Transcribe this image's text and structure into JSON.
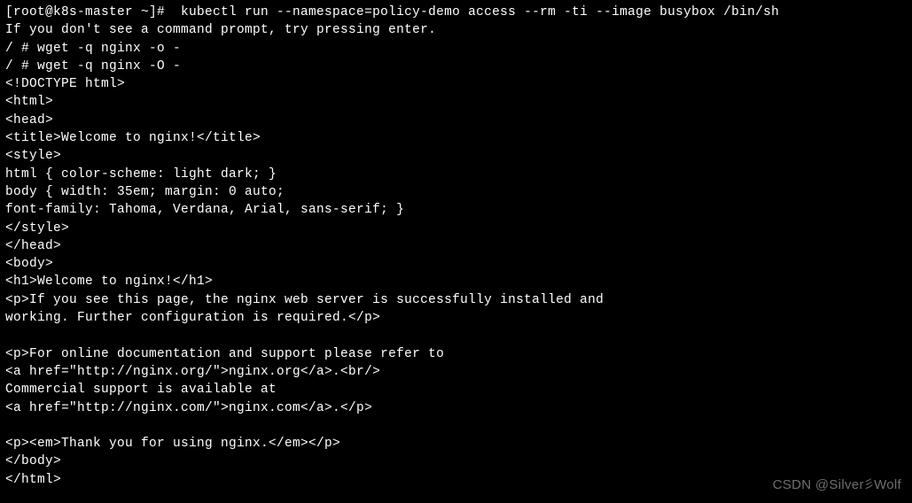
{
  "terminal": {
    "lines": [
      "[root@k8s-master ~]#  kubectl run --namespace=policy-demo access --rm -ti --image busybox /bin/sh",
      "If you don't see a command prompt, try pressing enter.",
      "/ # wget -q nginx -o -",
      "/ # wget -q nginx -O -",
      "<!DOCTYPE html>",
      "<html>",
      "<head>",
      "<title>Welcome to nginx!</title>",
      "<style>",
      "html { color-scheme: light dark; }",
      "body { width: 35em; margin: 0 auto;",
      "font-family: Tahoma, Verdana, Arial, sans-serif; }",
      "</style>",
      "</head>",
      "<body>",
      "<h1>Welcome to nginx!</h1>",
      "<p>If you see this page, the nginx web server is successfully installed and",
      "working. Further configuration is required.</p>",
      "",
      "<p>For online documentation and support please refer to",
      "<a href=\"http://nginx.org/\">nginx.org</a>.<br/>",
      "Commercial support is available at",
      "<a href=\"http://nginx.com/\">nginx.com</a>.</p>",
      "",
      "<p><em>Thank you for using nginx.</em></p>",
      "</body>",
      "</html>"
    ]
  },
  "watermark": {
    "prefix": "CSDN @Silver",
    "suffix": "Wolf"
  }
}
